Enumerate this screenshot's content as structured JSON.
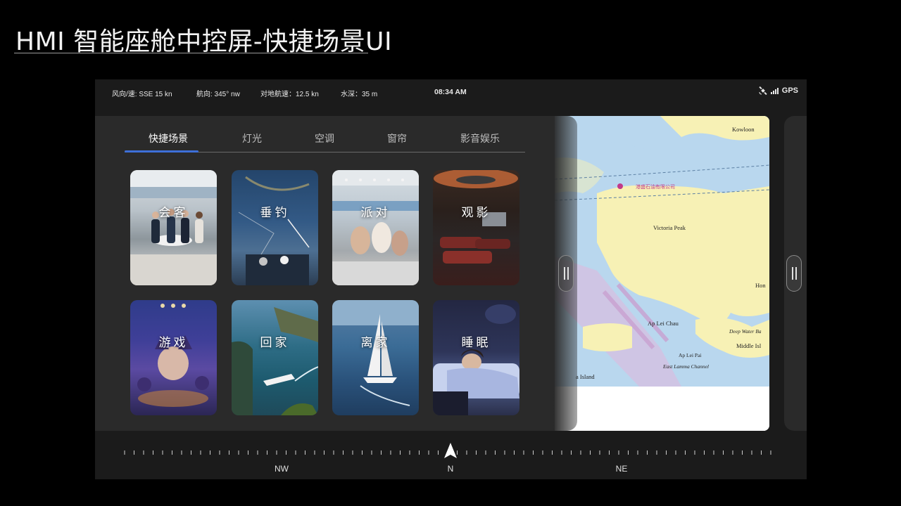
{
  "title": "HMI 智能座舱中控屏-快捷场景UI",
  "status": {
    "wind": "风向/速: SSE 15 kn",
    "heading": "航向: 345° nw",
    "sog": "对地航速：12.5 kn",
    "depth": "水深：35 m",
    "time": "08:34 AM",
    "gps": "GPS",
    "icons": [
      "satellite-icon",
      "signal-bars-icon"
    ]
  },
  "tabs": [
    {
      "label": "快捷场景",
      "active": true
    },
    {
      "label": "灯光",
      "active": false
    },
    {
      "label": "空调",
      "active": false
    },
    {
      "label": "窗帘",
      "active": false
    },
    {
      "label": "影音娱乐",
      "active": false
    }
  ],
  "scenes": [
    {
      "label": "会客"
    },
    {
      "label": "垂钓"
    },
    {
      "label": "派对"
    },
    {
      "label": "观影"
    },
    {
      "label": "游戏"
    },
    {
      "label": "回家"
    },
    {
      "label": "离家"
    },
    {
      "label": "睡眠"
    }
  ],
  "map": {
    "labels": [
      "Kowloon",
      "Victoria Peak",
      "Hon",
      "Ap Lei Chau",
      "Deep Water Ba",
      "Middle Isl",
      "Ap Lei Pai",
      "East Lamma Channel",
      "a Island"
    ],
    "marker": "港盛石油有限公司",
    "colors": {
      "land": "#f7f1b5",
      "water": "#ffffff",
      "shallow": "#b9d7ee",
      "channel": "#c9a0cf"
    }
  },
  "compass": {
    "labels": [
      "NW",
      "N",
      "NE"
    ],
    "pointer": "north-arrow-icon"
  },
  "colors": {
    "accent": "#3d6fd8",
    "panel": "#2a2a2a",
    "screen": "#1b1b1b"
  }
}
